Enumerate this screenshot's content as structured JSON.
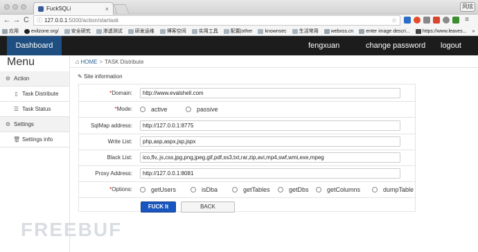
{
  "browser": {
    "tab_title": "FuckSQLi",
    "tab_close": "×",
    "user_button": "风炫",
    "url_host": "127.0.0.1",
    "url_path": ":5000/action/startask",
    "nav": {
      "back": "←",
      "forward": "→",
      "reload": "C"
    },
    "bookmarks": [
      "应用",
      "evilzone.org/",
      "安全研究",
      "渗透测试",
      "研发运维",
      "博客空间",
      "实用工具",
      "配置|other",
      "knownsec",
      "生活常用",
      "webxss.cn",
      "enter image descri...",
      "https://www.leaves...",
      "»"
    ]
  },
  "navbar": {
    "brand": "Dashboard",
    "username": "fengxuan",
    "change_password": "change password",
    "logout": "logout"
  },
  "sidebar": {
    "title": "Menu",
    "sections": [
      {
        "label": "Action",
        "icon": "gear-icon",
        "items": [
          {
            "label": "Task Distribute",
            "icon": "document-icon"
          },
          {
            "label": "Task Status",
            "icon": "list-icon"
          }
        ]
      },
      {
        "label": "Settings",
        "icon": "gear-icon",
        "items": [
          {
            "label": "Settings info",
            "icon": "trash-icon"
          }
        ]
      }
    ]
  },
  "breadcrumb": {
    "home": "HOME",
    "separator": ">",
    "current": "TASK Distribute"
  },
  "section_title": "Site information",
  "form": {
    "domain": {
      "label": "Domain:",
      "value": "http://www.evalshell.com"
    },
    "mode": {
      "label": "Mode:",
      "options": [
        "active",
        "passive"
      ]
    },
    "sqlmap": {
      "label": "SqlMap address:",
      "value": "http://127.0.0.1:8775"
    },
    "write_list": {
      "label": "Write List:",
      "value": "php,asp,aspx,jsp,jspx"
    },
    "black_list": {
      "label": "Black List:",
      "value": "ico,flv,.js,css,jpg,png,jpeg,gif,pdf,ss3,txt,rar,zip,avi,mp4,swf,wmi,exe,mpeg"
    },
    "proxy": {
      "label": "Proxy Address:",
      "value": "http://127.0.0.1:8081"
    },
    "options": {
      "label": "Options:",
      "items": [
        "getUsers",
        "isDba",
        "getTables",
        "getDbs",
        "getColumns",
        "dumpTable"
      ]
    },
    "submit_label": "FUCK It",
    "back_label": "BACK"
  },
  "watermark": "FREEBUF",
  "colors": {
    "navbar": "#1c1c1c",
    "brand": "#1e4f80",
    "primary_button": "#1a56c0",
    "required": "#c00000"
  }
}
